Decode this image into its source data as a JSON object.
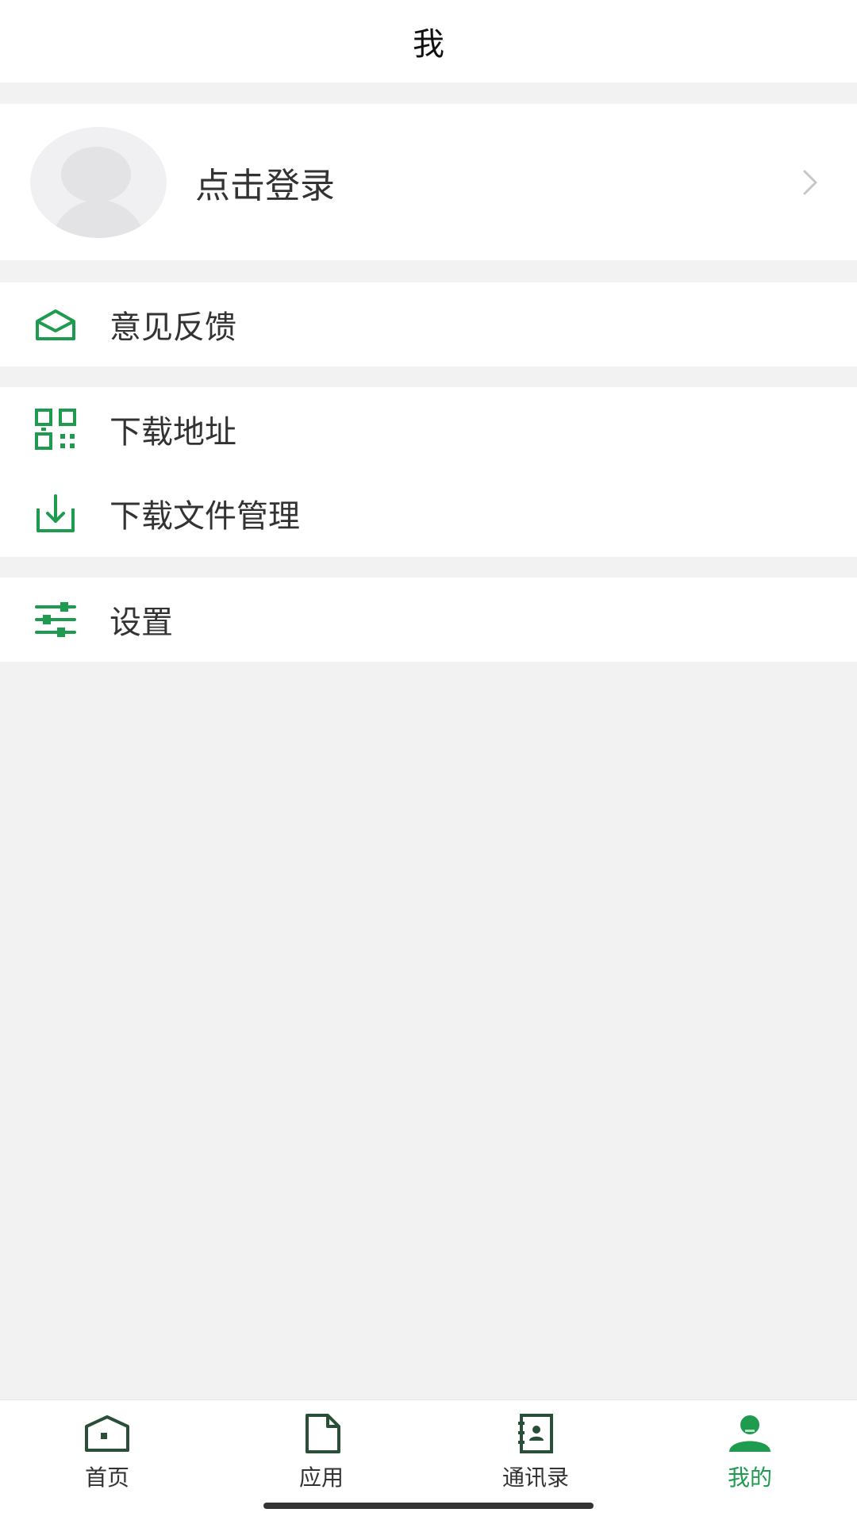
{
  "header": {
    "title": "我"
  },
  "profile": {
    "label": "点击登录"
  },
  "menu": {
    "feedback": "意见反馈",
    "download_address": "下载地址",
    "download_manager": "下载文件管理",
    "settings": "设置"
  },
  "bottom_nav": {
    "items": [
      {
        "label": "首页",
        "icon": "home-icon"
      },
      {
        "label": "应用",
        "icon": "document-icon"
      },
      {
        "label": "通讯录",
        "icon": "contacts-icon"
      },
      {
        "label": "我的",
        "icon": "user-icon",
        "active": true
      }
    ]
  },
  "colors": {
    "accent": "#1f9b4f",
    "text": "#333333",
    "background": "#f2f2f2"
  }
}
